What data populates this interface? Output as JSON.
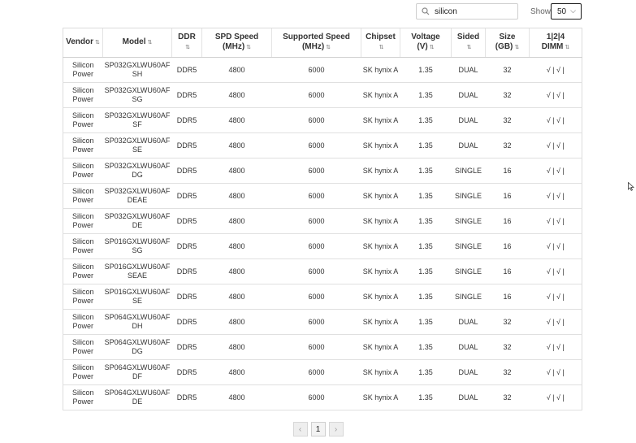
{
  "search": {
    "value": "silicon",
    "icon": "search-icon"
  },
  "show": {
    "label": "Show:",
    "selected": "50",
    "icon": "chevron-down-icon"
  },
  "sort_glyph": "⇅",
  "table": {
    "columns": [
      {
        "line1": "Vendor",
        "line2": ""
      },
      {
        "line1": "Model",
        "line2": ""
      },
      {
        "line1": "DDR",
        "line2": ""
      },
      {
        "line1": "SPD Speed",
        "line2": "(MHz)"
      },
      {
        "line1": "Supported Speed",
        "line2": "(MHz)"
      },
      {
        "line1": "Chipset",
        "line2": ""
      },
      {
        "line1": "Voltage",
        "line2": "(V)"
      },
      {
        "line1": "Sided",
        "line2": ""
      },
      {
        "line1": "Size",
        "line2": "(GB)"
      },
      {
        "line1": "1|2|4",
        "line2": "DIMM"
      }
    ],
    "rows": [
      [
        "Silicon Power",
        "SP032GXLWU60AFSH",
        "DDR5",
        "4800",
        "6000",
        "SK hynix A",
        "1.35",
        "DUAL",
        "32",
        "√ | √ |"
      ],
      [
        "Silicon Power",
        "SP032GXLWU60AFSG",
        "DDR5",
        "4800",
        "6000",
        "SK hynix A",
        "1.35",
        "DUAL",
        "32",
        "√ | √ |"
      ],
      [
        "Silicon Power",
        "SP032GXLWU60AFSF",
        "DDR5",
        "4800",
        "6000",
        "SK hynix A",
        "1.35",
        "DUAL",
        "32",
        "√ | √ |"
      ],
      [
        "Silicon Power",
        "SP032GXLWU60AFSE",
        "DDR5",
        "4800",
        "6000",
        "SK hynix A",
        "1.35",
        "DUAL",
        "32",
        "√ | √ |"
      ],
      [
        "Silicon Power",
        "SP032GXLWU60AFDG",
        "DDR5",
        "4800",
        "6000",
        "SK hynix A",
        "1.35",
        "SINGLE",
        "16",
        "√ | √ |"
      ],
      [
        "Silicon Power",
        "SP032GXLWU60AFDEAE",
        "DDR5",
        "4800",
        "6000",
        "SK hynix A",
        "1.35",
        "SINGLE",
        "16",
        "√ | √ |"
      ],
      [
        "Silicon Power",
        "SP032GXLWU60AFDE",
        "DDR5",
        "4800",
        "6000",
        "SK hynix A",
        "1.35",
        "SINGLE",
        "16",
        "√ | √ |"
      ],
      [
        "Silicon Power",
        "SP016GXLWU60AFSG",
        "DDR5",
        "4800",
        "6000",
        "SK hynix A",
        "1.35",
        "SINGLE",
        "16",
        "√ | √ |"
      ],
      [
        "Silicon Power",
        "SP016GXLWU60AFSEAE",
        "DDR5",
        "4800",
        "6000",
        "SK hynix A",
        "1.35",
        "SINGLE",
        "16",
        "√ | √ |"
      ],
      [
        "Silicon Power",
        "SP016GXLWU60AFSE",
        "DDR5",
        "4800",
        "6000",
        "SK hynix A",
        "1.35",
        "SINGLE",
        "16",
        "√ | √ |"
      ],
      [
        "Silicon Power",
        "SP064GXLWU60AFDH",
        "DDR5",
        "4800",
        "6000",
        "SK hynix A",
        "1.35",
        "DUAL",
        "32",
        "√ | √ |"
      ],
      [
        "Silicon Power",
        "SP064GXLWU60AFDG",
        "DDR5",
        "4800",
        "6000",
        "SK hynix A",
        "1.35",
        "DUAL",
        "32",
        "√ | √ |"
      ],
      [
        "Silicon Power",
        "SP064GXLWU60AFDF",
        "DDR5",
        "4800",
        "6000",
        "SK hynix A",
        "1.35",
        "DUAL",
        "32",
        "√ | √ |"
      ],
      [
        "Silicon Power",
        "SP064GXLWU60AFDE",
        "DDR5",
        "4800",
        "6000",
        "SK hynix A",
        "1.35",
        "DUAL",
        "32",
        "√ | √ |"
      ]
    ]
  },
  "pagination": {
    "prev": "‹",
    "current": "1",
    "next": "›"
  }
}
